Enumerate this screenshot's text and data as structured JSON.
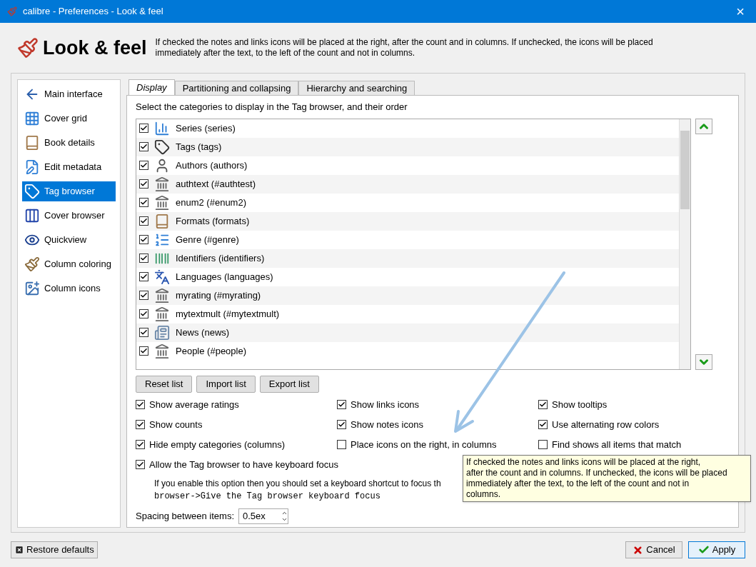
{
  "window": {
    "title": "calibre - Preferences - Look & feel",
    "close": "×"
  },
  "header": {
    "title": "Look & feel",
    "description": "If checked the notes and links icons will be placed at the right, after the count and in columns. If unchecked, the icons will be placed immediately after the text, to the left of the count and not in columns."
  },
  "sidebar": {
    "items": [
      {
        "label": "Main interface",
        "selected": false
      },
      {
        "label": "Cover grid",
        "selected": false
      },
      {
        "label": "Book details",
        "selected": false
      },
      {
        "label": "Edit metadata",
        "selected": false
      },
      {
        "label": "Tag browser",
        "selected": true
      },
      {
        "label": "Cover browser",
        "selected": false
      },
      {
        "label": "Quickview",
        "selected": false
      },
      {
        "label": "Column coloring",
        "selected": false
      },
      {
        "label": "Column icons",
        "selected": false
      }
    ]
  },
  "tabs": [
    {
      "label": "Display",
      "selected": true
    },
    {
      "label": "Partitioning and collapsing",
      "selected": false
    },
    {
      "label": "Hierarchy and searching",
      "selected": false
    }
  ],
  "categories_label": "Select the categories to display in the Tag browser, and their order",
  "categories": [
    {
      "label": "Series (series)",
      "checked": true
    },
    {
      "label": "Tags (tags)",
      "checked": true
    },
    {
      "label": "Authors (authors)",
      "checked": true
    },
    {
      "label": "authtext (#authtest)",
      "checked": true
    },
    {
      "label": "enum2 (#enum2)",
      "checked": true
    },
    {
      "label": "Formats (formats)",
      "checked": true
    },
    {
      "label": "Genre (#genre)",
      "checked": true
    },
    {
      "label": "Identifiers (identifiers)",
      "checked": true
    },
    {
      "label": "Languages (languages)",
      "checked": true
    },
    {
      "label": "myrating (#myrating)",
      "checked": true
    },
    {
      "label": "mytextmult (#mytextmult)",
      "checked": true
    },
    {
      "label": "News (news)",
      "checked": true
    },
    {
      "label": "People (#people)",
      "checked": true
    }
  ],
  "list_buttons": [
    "Reset list",
    "Import list",
    "Export list"
  ],
  "options": [
    {
      "label": "Show average ratings",
      "checked": true
    },
    {
      "label": "Show links icons",
      "checked": true
    },
    {
      "label": "Show tooltips",
      "checked": true
    },
    {
      "label": "Show counts",
      "checked": true
    },
    {
      "label": "Show notes icons",
      "checked": true
    },
    {
      "label": "Use alternating row colors",
      "checked": true
    },
    {
      "label": "Hide empty categories (columns)",
      "checked": true
    },
    {
      "label": "Place icons on the right, in columns",
      "checked": false
    },
    {
      "label": "Find shows all items that match",
      "checked": false
    }
  ],
  "keyboard_focus": {
    "label": "Allow the Tag browser to have keyboard focus",
    "checked": true
  },
  "hint": {
    "line_1": "If you enable this option then you should set a keyboard shortcut to focus th",
    "line_2": "browser->Give the Tag browser keyboard focus"
  },
  "spacing": {
    "label": "Spacing between items:",
    "value": "0.5ex"
  },
  "tooltip": [
    "If checked the notes and links icons will be placed at the right,",
    "after the count and in columns. If unchecked, the icons will be placed",
    "immediately after the text, to the left of the count and not in",
    "columns."
  ],
  "footer": {
    "restore": "Restore defaults",
    "cancel": "Cancel",
    "apply": "Apply"
  }
}
